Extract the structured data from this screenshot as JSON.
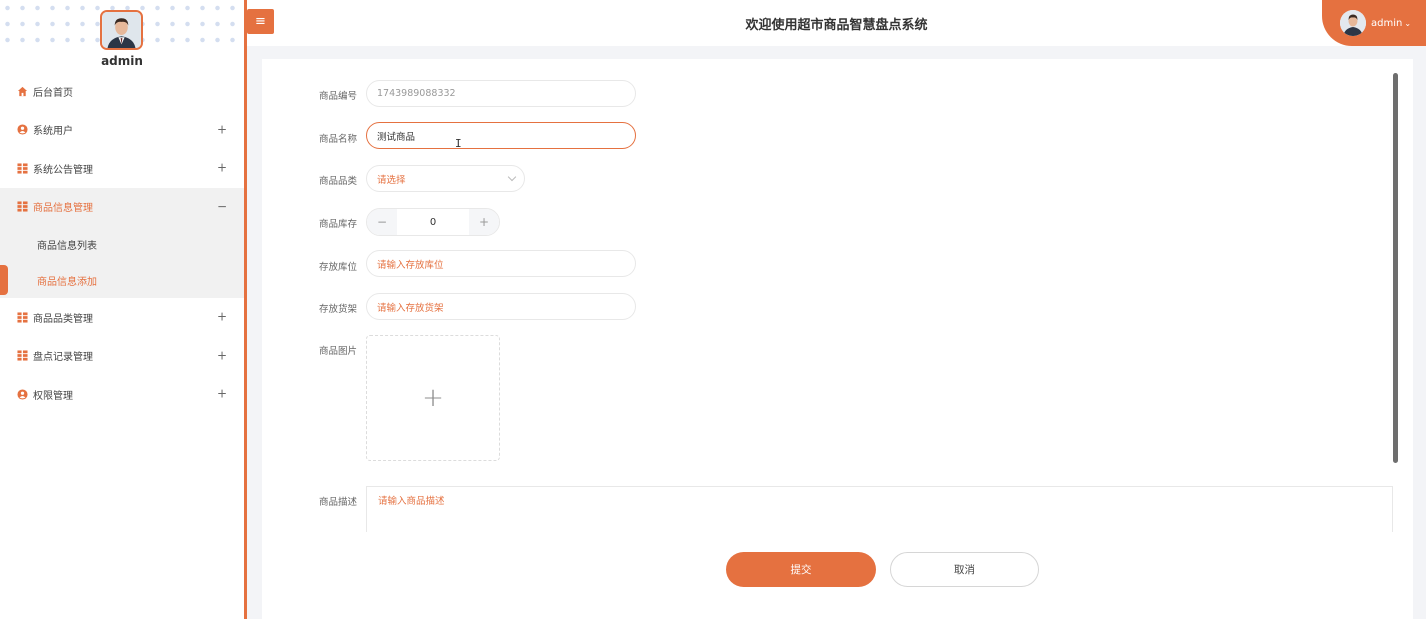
{
  "colors": {
    "accent": "#e57140",
    "background": "#f3f4f7"
  },
  "sidebar": {
    "username": "admin",
    "menu": [
      {
        "label": "后台首页",
        "icon": "home-icon",
        "toggle": ""
      },
      {
        "label": "系统用户",
        "icon": "user-circle-icon",
        "toggle": "+"
      },
      {
        "label": "系统公告管理",
        "icon": "grid-icon",
        "toggle": "+"
      },
      {
        "label": "商品信息管理",
        "icon": "grid-icon",
        "toggle": "−"
      },
      {
        "label": "商品品类管理",
        "icon": "grid-icon",
        "toggle": "+"
      },
      {
        "label": "盘点记录管理",
        "icon": "grid-icon",
        "toggle": "+"
      },
      {
        "label": "权限管理",
        "icon": "user-circle-icon",
        "toggle": "+"
      }
    ],
    "submenu": [
      {
        "label": "商品信息列表"
      },
      {
        "label": "商品信息添加"
      }
    ]
  },
  "header": {
    "menu_icon": "hamburger-icon",
    "title": "欢迎使用超市商品智慧盘点系统",
    "user": "admin"
  },
  "form": {
    "code": {
      "label": "商品编号",
      "value": "1743989088332"
    },
    "name": {
      "label": "商品名称",
      "value": "测试商品"
    },
    "category": {
      "label": "商品品类",
      "placeholder": "请选择"
    },
    "stock": {
      "label": "商品库存",
      "value": "0",
      "minus": "−",
      "plus": "+"
    },
    "location": {
      "label": "存放库位",
      "placeholder": "请输入存放库位"
    },
    "shelf": {
      "label": "存放货架",
      "placeholder": "请输入存放货架"
    },
    "image": {
      "label": "商品图片",
      "plus": "+"
    },
    "description": {
      "label": "商品描述",
      "placeholder": "请输入商品描述"
    },
    "submit": "提交",
    "cancel": "取消"
  }
}
